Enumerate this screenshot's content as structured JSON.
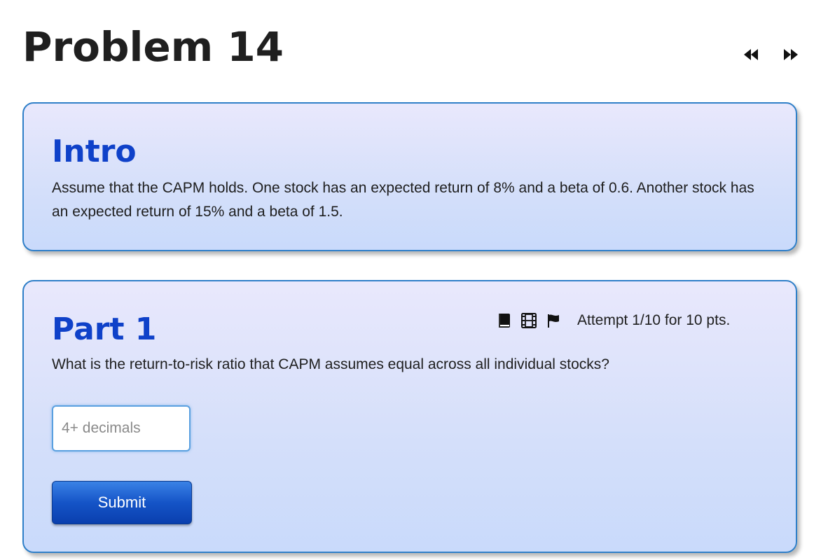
{
  "page": {
    "title": "Problem 14"
  },
  "nav": {
    "prev_icon": "fast-backward-icon",
    "next_icon": "fast-forward-icon"
  },
  "intro": {
    "heading": "Intro",
    "text": "Assume that the CAPM holds. One stock has an expected return of 8% and a beta of 0.6. Another stock has an expected return of 15% and a beta of 1.5."
  },
  "part1": {
    "heading": "Part 1",
    "tools": [
      "book-icon",
      "film-icon",
      "flag-icon"
    ],
    "attempt": "Attempt 1/10 for 10 pts.",
    "question": "What is the return-to-risk ratio that CAPM assumes equal across all individual stocks?",
    "answer": {
      "value": "",
      "placeholder": "4+ decimals"
    },
    "submit_label": "Submit"
  },
  "colors": {
    "accent": "#0f41c9",
    "card_border": "#2f7fc8",
    "button": "#1554c7"
  }
}
